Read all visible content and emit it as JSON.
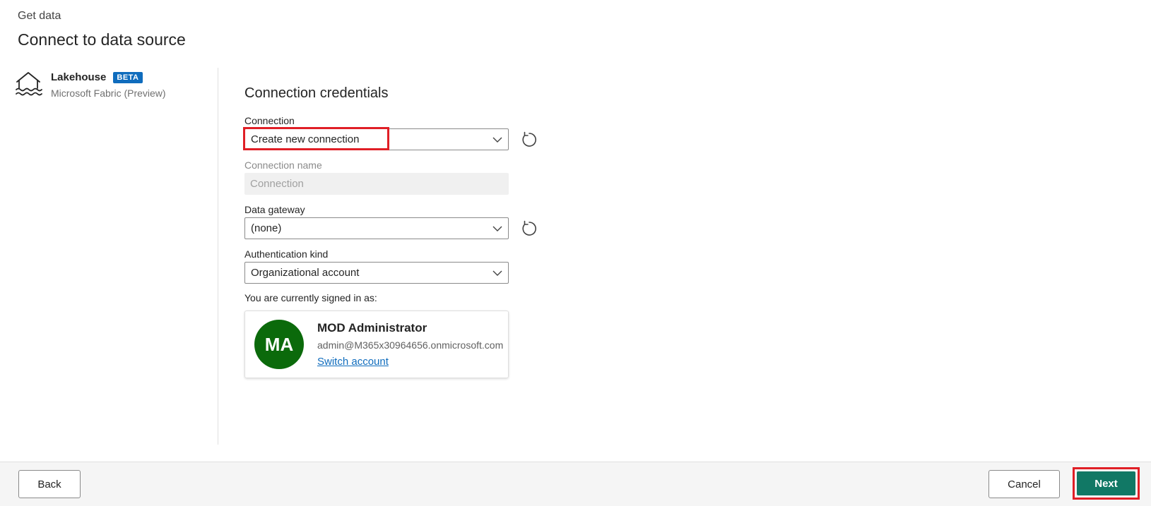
{
  "header": {
    "breadcrumb": "Get data",
    "title": "Connect to data source"
  },
  "source": {
    "name": "Lakehouse",
    "badge": "BETA",
    "subtitle": "Microsoft Fabric (Preview)",
    "icon": "lakehouse-icon"
  },
  "form": {
    "section_title": "Connection credentials",
    "connection": {
      "label": "Connection",
      "value": "Create new connection"
    },
    "connection_name": {
      "label": "Connection name",
      "placeholder": "Connection"
    },
    "data_gateway": {
      "label": "Data gateway",
      "value": "(none)"
    },
    "auth_kind": {
      "label": "Authentication kind",
      "value": "Organizational account"
    },
    "signed_in_label": "You are currently signed in as:",
    "account": {
      "initials": "MA",
      "name": "MOD Administrator",
      "email": "admin@M365x30964656.onmicrosoft.com",
      "switch_label": "Switch account",
      "avatar_color": "#0b6a0b"
    }
  },
  "footer": {
    "back_label": "Back",
    "cancel_label": "Cancel",
    "next_label": "Next"
  },
  "colors": {
    "accent": "#117865",
    "highlight": "#e01f26",
    "badge": "#0f6cbd",
    "link": "#0f6cbd"
  }
}
